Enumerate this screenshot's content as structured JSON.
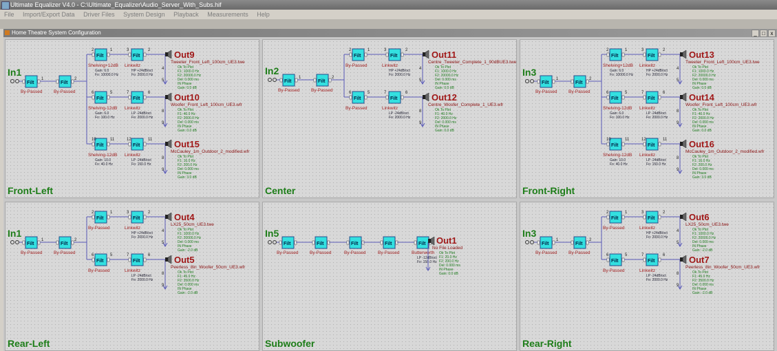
{
  "window_title": "Ultimate Equalizer V4.0 - C:\\Ultimate_Equalizer\\Audio_Server_With_Subs.hif",
  "menu": [
    "File",
    "Import/Export Data",
    "Driver Files",
    "System Design",
    "Playback",
    "Measurements",
    "Help"
  ],
  "child_title": "Home Theatre System Configuration",
  "child_buttons": [
    "_",
    "□",
    "x"
  ],
  "filter_text": "Filt",
  "phase_label": "IN Phase",
  "zones": [
    {
      "name": "Front-Left",
      "input": "In1",
      "in_labels": [
        "By-Passed",
        "By-Passed"
      ],
      "outs": [
        {
          "name": "Out9",
          "file": "Tweeter_Front_Left_100cm_UE3.twe",
          "f1_label": "Shelving+12dB",
          "f1_info": [
            "Gain: 6.0",
            "Fo: 10000.0 Hz"
          ],
          "f2_label": "Linkwitz",
          "f2_info": [
            "HP +24dB/oct",
            "Fo: 2000.0 Hz"
          ],
          "details": [
            "Ok To Plot",
            "F1: 1000.0 Hz",
            "F2: 20000.0 Hz",
            "Del: 0.000 ms",
            "IN Phase",
            "Gain: 0.0 dB"
          ],
          "nums": [
            "2",
            "1",
            "3",
            "2",
            "4",
            "5"
          ]
        },
        {
          "name": "Out10",
          "file": "Woofer_Front_Left_100cm_UE3.wfr",
          "f1_label": "Shelving-12dB",
          "f1_info": [
            "Gain: 6.0",
            "Fo: 100.0 Hz"
          ],
          "f2_label": "Linkwitz",
          "f2_info": [
            "LP -24dB/oct",
            "Fo: 2000.0 Hz"
          ],
          "details": [
            "Ok To Plot",
            "F1: 40.0 Hz",
            "F2: 2000.0 Hz",
            "Del: 0.000 ms",
            "IN Phase",
            "Gain: 0.0 dB"
          ],
          "nums": [
            "6",
            "5",
            "7",
            "6",
            "8",
            "9"
          ]
        },
        {
          "name": "Out15",
          "file": "McCauley_1m_Outdoor_2_modified.wfr",
          "f1_label": "Shelving-12dB",
          "f1_info": [
            "Gain: 10.0",
            "Fo: 40.0 Hz"
          ],
          "f2_label": "Linkwitz",
          "f2_info": [
            "LP -24dB/oct",
            "Fo: 150.0 Hz"
          ],
          "details": [
            "Ok To Plot",
            "F1: 16.0 Hz",
            "F2: 200.0 Hz",
            "Del: 0.000 ms",
            "IN Phase",
            "Gain: 3.0 dB"
          ],
          "nums": [
            "10",
            "11",
            "12",
            "11",
            "8",
            "9"
          ]
        }
      ]
    },
    {
      "name": "Center",
      "input": "In2",
      "in_labels": [
        "By-Passed",
        "By-Passed"
      ],
      "outs": [
        {
          "name": "Out11",
          "file": "Centre_Tweeter_Complete_1_90dBUE3.twe",
          "f1_label": "By-Passed",
          "f1_info": [],
          "f2_label": "Linkwitz",
          "f2_info": [
            "HP +24dB/oct",
            "Fo: 2000.0 Hz"
          ],
          "details": [
            "Ok To Plot",
            "F1: 1000.0 Hz",
            "F2: 20000.0 Hz",
            "Del: 0.000 ms",
            "IN Phase",
            "Gain: 0.0 dB"
          ],
          "nums": [
            "2",
            "1",
            "3",
            "2",
            "4",
            "5"
          ]
        },
        {
          "name": "Out12",
          "file": "Centre_Woofer_Complete_1_UE3.wfr",
          "f1_label": "By-Passed",
          "f1_info": [],
          "f2_label": "Linkwitz",
          "f2_info": [
            "LP -24dB/oct",
            "Fo: 2000.0 Hz"
          ],
          "details": [
            "Ok To Plot",
            "F1: 40.0 Hz",
            "F2: 2000.0 Hz",
            "Del: 0.000 ms",
            "IN Phase",
            "Gain: 0.0 dB"
          ],
          "nums": [
            "6",
            "5",
            "7",
            "6",
            "8",
            "9"
          ]
        }
      ]
    },
    {
      "name": "Front-Right",
      "input": "In3",
      "in_labels": [
        "By-Passed",
        "By-Passed"
      ],
      "outs": [
        {
          "name": "Out13",
          "file": "Tweeter_Front_Left_100cm_UE3.twe",
          "f1_label": "Shelving+12dB",
          "f1_info": [
            "Gain: 6.0",
            "Fo: 10000.0 Hz"
          ],
          "f2_label": "Linkwitz",
          "f2_info": [
            "HP +24dB/oct",
            "Fo: 2000.0 Hz"
          ],
          "details": [
            "Ok To Plot",
            "F1: 1000.0 Hz",
            "F2: 20000.0 Hz",
            "Del: 0.000 ms",
            "IN Phase",
            "Gain: 0.0 dB"
          ],
          "nums": [
            "2",
            "1",
            "3",
            "2",
            "4",
            "5"
          ]
        },
        {
          "name": "Out14",
          "file": "Woofer_Front_Left_100cm_UE3.wfr",
          "f1_label": "Shelving-12dB",
          "f1_info": [
            "Gain: 6.0",
            "Fo: 100.0 Hz"
          ],
          "f2_label": "Linkwitz",
          "f2_info": [
            "LP -24dB/oct",
            "Fo: 2000.0 Hz"
          ],
          "details": [
            "Ok To Plot",
            "F1: 40.0 Hz",
            "F2: 2000.0 Hz",
            "Del: 0.000 ms",
            "IN Phase",
            "Gain: 0.0 dB"
          ],
          "nums": [
            "6",
            "5",
            "7",
            "6",
            "8",
            "9"
          ]
        },
        {
          "name": "Out16",
          "file": "McCauley_1m_Outdoor_2_modified.wfr",
          "f1_label": "Shelving-12dB",
          "f1_info": [
            "Gain: 10.0",
            "Fo: 40.0 Hz"
          ],
          "f2_label": "Linkwitz",
          "f2_info": [
            "LP -24dB/oct",
            "Fo: 150.0 Hz"
          ],
          "details": [
            "Ok To Plot",
            "F1: 16.0 Hz",
            "F2: 200.0 Hz",
            "Del: 0.000 ms",
            "IN Phase",
            "Gain: 3.0 dB"
          ],
          "nums": [
            "10",
            "11",
            "12",
            "11",
            "8",
            "9"
          ]
        }
      ]
    },
    {
      "name": "Rear-Left",
      "input": "In1",
      "in_labels": [
        "By-Passed",
        "By-Passed"
      ],
      "outs": [
        {
          "name": "Out4",
          "file": "LX25_50cm_UE3.twe",
          "f1_label": "By-Passed",
          "f1_info": [],
          "f2_label": "Linkwitz",
          "f2_info": [
            "HP +24dB/oct",
            "Fo: 2000.0 Hz"
          ],
          "details": [
            "Ok To Plot",
            "F1: 1000.0 Hz",
            "F2: 20000.0 Hz",
            "Del: 0.000 ms",
            "IN Phase",
            "Gain: -2.0 dB"
          ],
          "nums": [
            "2",
            "1",
            "3",
            "2",
            "4",
            "5"
          ]
        },
        {
          "name": "Out5",
          "file": "Peerless_8in_Woofer_50cm_UE3.wfr",
          "f1_label": "By-Passed",
          "f1_info": [],
          "f2_label": "Linkwitz",
          "f2_info": [
            "LP -24dB/oct",
            "Fo: 2000.0 Hz"
          ],
          "details": [
            "Ok To Plot",
            "F1: 45.0 Hz",
            "F2: 3500.0 Hz",
            "Del: 0.000 ms",
            "IN Phase",
            "Gain: -2.0 dB"
          ],
          "nums": [
            "6",
            "5",
            "7",
            "6",
            "8",
            "9"
          ]
        }
      ]
    },
    {
      "name": "Subwoofer",
      "input": "In5",
      "chain_labels": [
        "By-Passed",
        "By-Passed",
        "By-Passed",
        "By-Passed",
        "Butterworth"
      ],
      "chain_info": [
        "LP -12dB/oct",
        "Fo: 150.0 Hz"
      ],
      "outs": [
        {
          "name": "Out1",
          "file": "No File Loaded",
          "details": [
            "Ok To Plot",
            "F1: 20.0 Hz",
            "F2: 200.0 Hz",
            "Del: 0.000 ms",
            "IN Phase",
            "Gain: 0.0 dB"
          ],
          "nums": [
            "2",
            "1",
            "3",
            "2",
            "4",
            "3",
            "5",
            "4"
          ]
        }
      ]
    },
    {
      "name": "Rear-Right",
      "input": "In3",
      "in_labels": [
        "By-Passed",
        "By-Passed"
      ],
      "outs": [
        {
          "name": "Out6",
          "file": "LX25_50cm_UE3.twe",
          "f1_label": "By-Passed",
          "f1_info": [],
          "f2_label": "Linkwitz",
          "f2_info": [
            "HP +24dB/oct",
            "Fo: 2000.0 Hz"
          ],
          "details": [
            "Ok To Plot",
            "F1: 1000.0 Hz",
            "F2: 20000.0 Hz",
            "Del: 0.000 ms",
            "IN Phase",
            "Gain: -2.0 dB"
          ],
          "nums": [
            "2",
            "1",
            "3",
            "2",
            "4",
            "5"
          ]
        },
        {
          "name": "Out7",
          "file": "Peerless_8in_Woofer_50cm_UE3.wfr",
          "f1_label": "By-Passed",
          "f1_info": [],
          "f2_label": "Linkwitz",
          "f2_info": [
            "LP -24dB/oct",
            "Fo: 2000.0 Hz"
          ],
          "details": [
            "Ok To Plot",
            "F1: 45.0 Hz",
            "F2: 3500.0 Hz",
            "Del: 0.000 ms",
            "IN Phase",
            "Gain: -2.0 dB"
          ],
          "nums": [
            "6",
            "5",
            "7",
            "6",
            "8",
            "9"
          ]
        }
      ]
    }
  ]
}
